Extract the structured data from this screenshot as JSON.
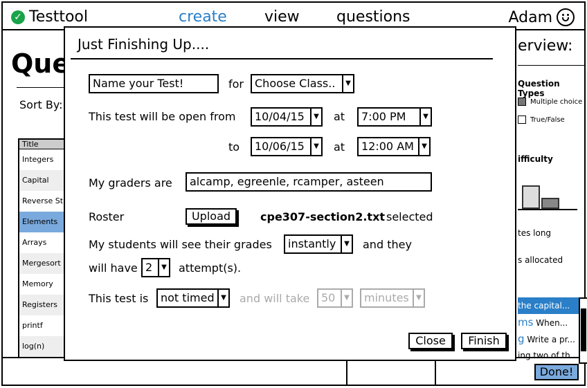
{
  "app": {
    "name": "Testtool",
    "user": "Adam"
  },
  "nav": {
    "create": "create",
    "view": "view",
    "questions": "questions"
  },
  "background": {
    "title_fragment": "Que",
    "sort_by": "Sort By:",
    "list_header": "Title",
    "list_items": [
      "Integers",
      "Capital",
      "Reverse Str",
      "Elements",
      "Arrays",
      "Mergesort",
      "Memory",
      "Registers",
      "printf",
      "log(n)"
    ],
    "overview_fragment": "erview:",
    "question_types": "Question Types",
    "legend_multiple": "Multiple choice",
    "legend_truefalse": "True/False",
    "difficulty": "ifficulty",
    "minutes_long": "tes long",
    "allocated": "s allocated",
    "right_list": [
      {
        "text": "the capital..."
      },
      {
        "big": "ms",
        "text": " When..."
      },
      {
        "big": "g",
        "text": " Write a pr..."
      },
      {
        "text": "ing two of th."
      }
    ],
    "done_button": "Done!"
  },
  "modal": {
    "title": "Just Finishing Up....",
    "test_name_placeholder": "Name your Test!",
    "for_label": "for",
    "class_select": "Choose Class..",
    "open_from_label": "This test will be open from",
    "from_date": "10/04/15",
    "at_label": "at",
    "from_time": "7:00 PM",
    "to_label": "to",
    "to_date": "10/06/15",
    "to_time": "12:00 AM",
    "graders_label": "My graders are",
    "graders_value": "alcamp, egreenle, rcamper, asteen",
    "roster_label": "Roster",
    "upload_button": "Upload",
    "roster_file": "cpe307-section2.txt",
    "roster_selected": "selected",
    "grades_label": "My students will see their grades",
    "grades_select": "instantly",
    "and_they": "and they",
    "will_have": "will have",
    "attempts_select": "2",
    "attempts_label": "attempt(s).",
    "timed_label": "This test is",
    "timed_select": "not timed",
    "will_take": "and will take",
    "duration_select": "50",
    "units_select": "minutes",
    "close_button": "Close",
    "finish_button": "Finish"
  }
}
